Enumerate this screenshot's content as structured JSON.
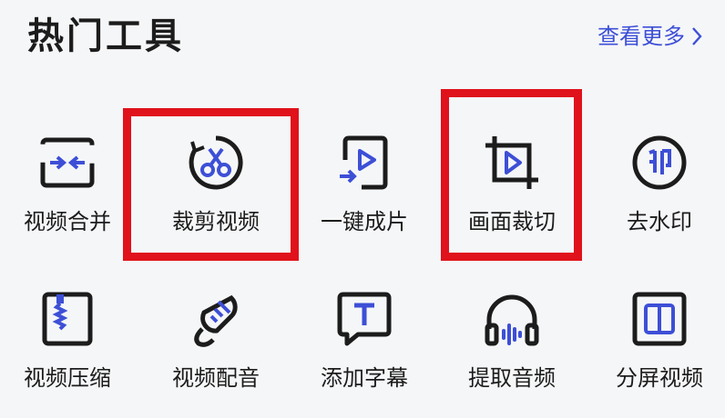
{
  "header": {
    "title": "热门工具",
    "more_label": "查看更多"
  },
  "colors": {
    "accent": "#3d4fd6",
    "icon_dark": "#1c1c1c",
    "highlight": "#e0121b"
  },
  "tools": [
    {
      "label": "视频合并",
      "icon": "merge-icon",
      "highlighted": false
    },
    {
      "label": "裁剪视频",
      "icon": "scissors-icon",
      "highlighted": true
    },
    {
      "label": "一键成片",
      "icon": "one-click-video-icon",
      "highlighted": false
    },
    {
      "label": "画面裁切",
      "icon": "crop-play-icon",
      "highlighted": true
    },
    {
      "label": "去水印",
      "icon": "watermark-stamp-icon",
      "highlighted": false
    },
    {
      "label": "视频压缩",
      "icon": "zip-compress-icon",
      "highlighted": false
    },
    {
      "label": "视频配音",
      "icon": "microphone-icon",
      "highlighted": false
    },
    {
      "label": "添加字幕",
      "icon": "text-bubble-icon",
      "highlighted": false
    },
    {
      "label": "提取音频",
      "icon": "headphones-icon",
      "highlighted": false
    },
    {
      "label": "分屏视频",
      "icon": "split-screen-icon",
      "highlighted": false
    }
  ]
}
